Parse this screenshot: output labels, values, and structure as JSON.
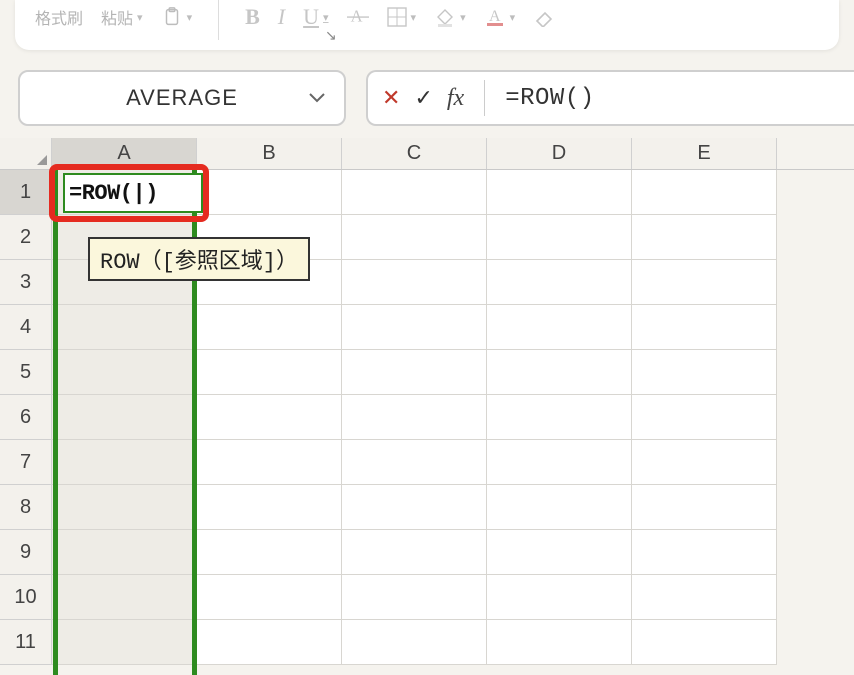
{
  "ribbon": {
    "format_painter": "格式刷",
    "paste": "粘贴",
    "bold": "B",
    "italic": "I",
    "underline": "U"
  },
  "namebox": {
    "value": "AVERAGE"
  },
  "formulabar": {
    "cancel_glyph": "✕",
    "confirm_glyph": "✓",
    "fx_label": "fx",
    "formula": "=ROW()"
  },
  "grid": {
    "columns": [
      "A",
      "B",
      "C",
      "D",
      "E"
    ],
    "rows": [
      "1",
      "2",
      "3",
      "4",
      "5",
      "6",
      "7",
      "8",
      "9",
      "10",
      "11"
    ],
    "active_cell_text": "=ROW(|)",
    "tooltip": "ROW（[参照区域]）"
  }
}
